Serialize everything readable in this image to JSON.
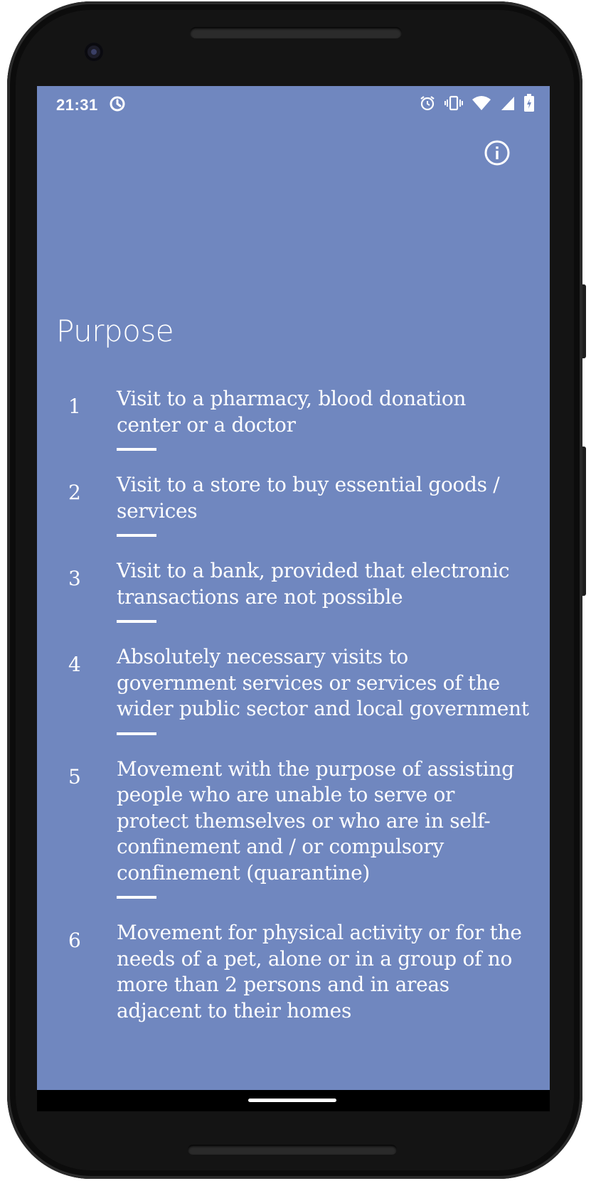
{
  "status_bar": {
    "time": "21:31",
    "left_icon": "data-saver-icon",
    "right_icons": [
      "alarm-icon",
      "vibrate-icon",
      "wifi-icon",
      "cellular-signal-icon",
      "battery-charging-icon"
    ]
  },
  "header": {
    "info_icon": "info-icon"
  },
  "page": {
    "title": "Purpose"
  },
  "purposes": [
    {
      "number": "1",
      "text": "Visit to a pharmacy, blood donation center or a doctor"
    },
    {
      "number": "2",
      "text": "Visit to a store to buy essential goods / services"
    },
    {
      "number": "3",
      "text": "Visit to a bank, provided that electronic transactions are not possible"
    },
    {
      "number": "4",
      "text": "Absolutely necessary visits to government services or services of the wider public sector and local government"
    },
    {
      "number": "5",
      "text": "Movement with the purpose of assisting people who are unable to serve or protect themselves or who are in self-confinement and / or compulsory confinement (quarantine)"
    },
    {
      "number": "6",
      "text": "Movement for physical activity or for the needs of a pet, alone or in a group of no more than 2 persons and in areas adjacent to their homes"
    }
  ],
  "colors": {
    "screen_background": "#7087bf",
    "text": "#ffffff"
  }
}
